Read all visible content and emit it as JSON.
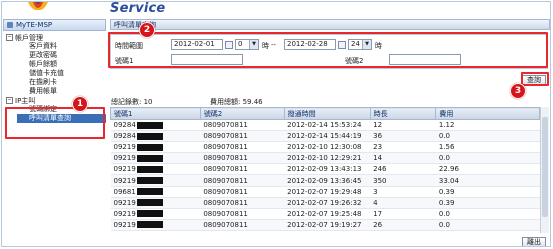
{
  "header": {
    "brand": "Service"
  },
  "sidebar": {
    "title": "MyTE-MSP",
    "groups": [
      {
        "label": "帳戶管理",
        "toggle": "−",
        "items": [
          "客戶資料",
          "更改密碼",
          "帳戶餘額",
          "儲值卡充值",
          "在擔刷卡",
          "費用帳單"
        ]
      },
      {
        "label": "IP主叫",
        "toggle": "−",
        "items": [
          "號碼綁定",
          "呼叫清單查詢"
        ]
      }
    ]
  },
  "main": {
    "title": "呼叫清單查詢",
    "form": {
      "time_range_label": "時間範圍",
      "start_date": "2012-02-01",
      "start_hour": "0",
      "hour_suffix": "時",
      "separator": "--",
      "end_date": "2012-02-28",
      "end_hour": "24",
      "number1_label": "號碼1",
      "number2_label": "號碼2",
      "number1_value": "",
      "number2_value": ""
    },
    "query_button": "查詢",
    "stats": {
      "total_records_label": "總記錄數:",
      "total_records": "10",
      "total_fee_label": "費用總額:",
      "total_fee": "59.46"
    },
    "table": {
      "headers": [
        "號碼1",
        "號碼2",
        "撥通時間",
        "時長",
        "費用"
      ],
      "rows": [
        [
          "09284",
          "0809070811",
          "2012-02-14 15:53:24",
          "12",
          "1.12"
        ],
        [
          "09284",
          "0809070811",
          "2012-02-14 15:44:19",
          "36",
          "0.0"
        ],
        [
          "09219",
          "0809070811",
          "2012-02-10 12:30:08",
          "23",
          "1.56"
        ],
        [
          "09219",
          "0809070811",
          "2012-02-10 12:29:21",
          "14",
          "0.0"
        ],
        [
          "09219",
          "0809070811",
          "2012-02-09 13:43:13",
          "246",
          "22.96"
        ],
        [
          "09219",
          "0809070811",
          "2012-02-09 13:36:45",
          "350",
          "33.04"
        ],
        [
          "09681",
          "0809070811",
          "2012-02-07 19:29:48",
          "3",
          "0.39"
        ],
        [
          "09219",
          "0809070811",
          "2012-02-07 19:26:32",
          "4",
          "0.39"
        ],
        [
          "09219",
          "0809070811",
          "2012-02-07 19:25:48",
          "17",
          "0.0"
        ],
        [
          "09219",
          "0809070811",
          "2012-02-07 19:19:27",
          "26",
          "0.0"
        ]
      ]
    },
    "exit_button": "離出"
  },
  "annotations": [
    "1",
    "2",
    "3"
  ],
  "colors": {
    "highlight": "#e8282d",
    "badge": "#d7141a",
    "selected": "#3a6fb8",
    "brand": "#2a4fa0"
  }
}
